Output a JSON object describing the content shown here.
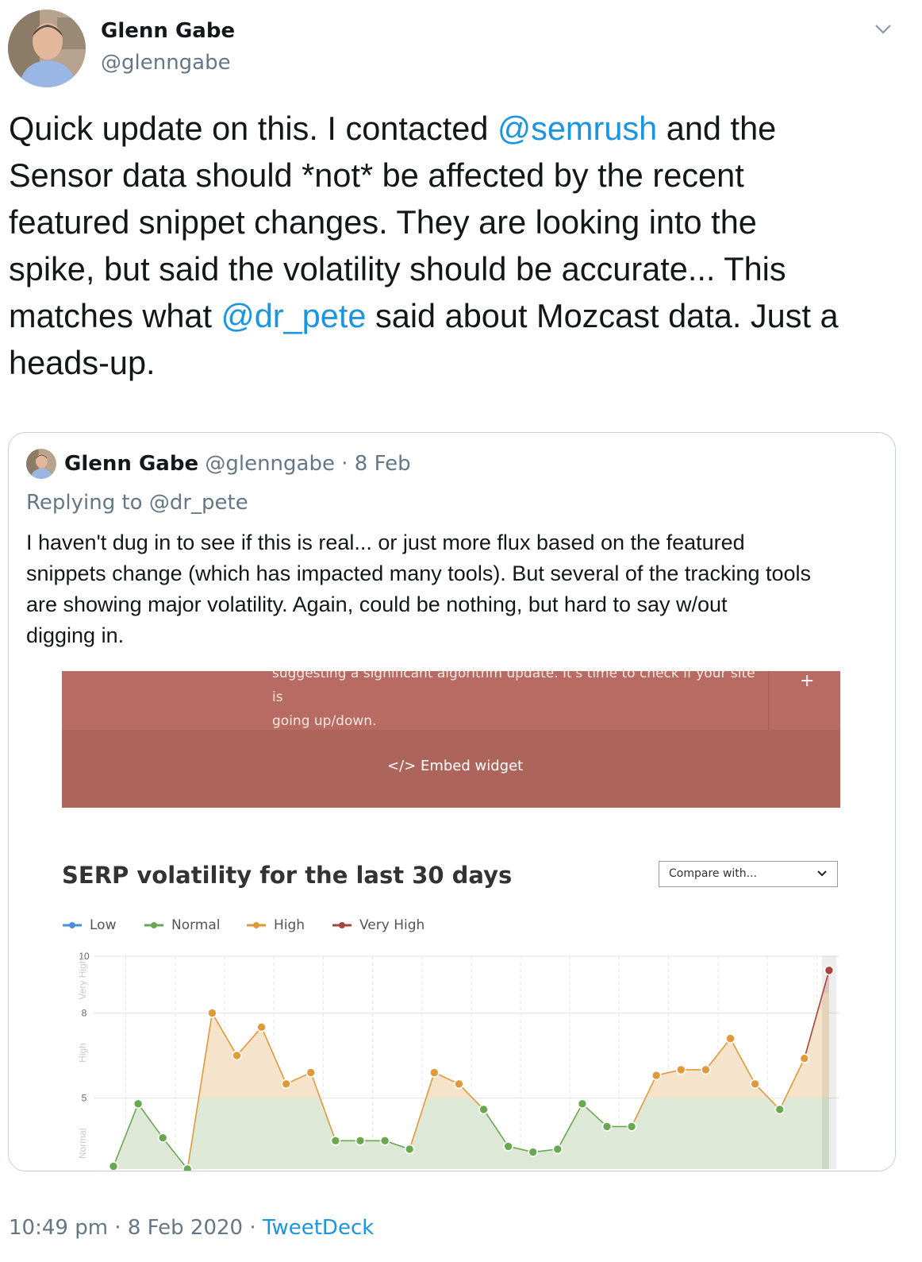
{
  "author": {
    "name": "Glenn Gabe",
    "handle": "@glenngabe"
  },
  "tweet": {
    "part1": "Quick update on this. I contacted ",
    "mention1": "@semrush",
    "part2": " and the\nSensor data should *not* be affected by the recent\nfeatured snippet changes. They are looking into the\nspike, but said the volatility should be accurate... This\nmatches what ",
    "mention2": "@dr_pete",
    "part3": " said about Mozcast data. Just a\nheads-up."
  },
  "quoted_tweet": {
    "name": "Glenn Gabe",
    "handle": "@glenngabe",
    "separator": " · ",
    "date": "8 Feb",
    "replying_to": "Replying to @dr_pete",
    "text": "I haven't dug in to see if this is real... or just more flux based on the featured\nsnippets change (which has impacted many tools). But several of the tracking tools\nare showing major volatility. Again, could be nothing, but hard to say w/out\ndigging in."
  },
  "screenshot": {
    "banner_text": "suggesting a significant algorithm update. It's time to check if your site is\ngoing up/down.",
    "banner_plus": "+",
    "embed_label": "</>  Embed widget",
    "compare_placeholder": "Compare with..."
  },
  "colors": {
    "low": "#4a90d9",
    "normal": "#6aa84f",
    "high": "#e09a3a",
    "very_high": "#a8453c",
    "link": "#1b95e0",
    "banner": "#b86b62"
  },
  "chart_data": {
    "type": "line",
    "title": "SERP volatility for the last 30 days",
    "legend": [
      "Low",
      "Normal",
      "High",
      "Very High"
    ],
    "legend_position": "top-left",
    "y_ticks": [
      "10",
      "8",
      "5"
    ],
    "y_bands": [
      "Very High",
      "High",
      "Normal"
    ],
    "ylim": [
      2.5,
      10
    ],
    "grid": true,
    "x": [
      1,
      2,
      3,
      4,
      5,
      6,
      7,
      8,
      9,
      10,
      11,
      12,
      13,
      14,
      15,
      16,
      17,
      18,
      19,
      20,
      21,
      22,
      23,
      24,
      25,
      26,
      27,
      28,
      29,
      30
    ],
    "values": [
      2.6,
      4.8,
      3.6,
      2.5,
      8.0,
      6.5,
      7.5,
      5.5,
      5.9,
      3.5,
      3.5,
      3.5,
      3.2,
      5.9,
      5.5,
      4.6,
      3.3,
      3.1,
      3.2,
      4.8,
      4.0,
      4.0,
      5.8,
      6.0,
      6.0,
      7.1,
      5.5,
      4.6,
      6.4,
      9.5
    ],
    "levels": [
      "normal",
      "normal",
      "normal",
      "normal",
      "high",
      "high",
      "high",
      "high",
      "high",
      "normal",
      "normal",
      "normal",
      "normal",
      "high",
      "high",
      "normal",
      "normal",
      "normal",
      "normal",
      "normal",
      "normal",
      "normal",
      "high",
      "high",
      "high",
      "high",
      "high",
      "normal",
      "high",
      "very_high"
    ]
  },
  "footer": {
    "time": "10:49 pm",
    "separator": " · ",
    "date": "8 Feb 2020",
    "source": "TweetDeck"
  }
}
